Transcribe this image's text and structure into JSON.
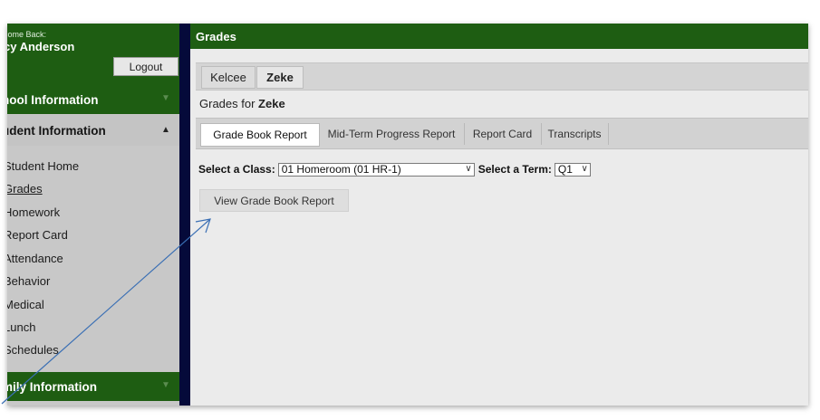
{
  "sidebar": {
    "welcome_small": "come Back:",
    "user_name": "cy Anderson",
    "logout_label": "Logout",
    "sections": {
      "school": "hool Information",
      "student": "udent Information",
      "family": "mily Information"
    },
    "items": [
      {
        "label": "Student Home"
      },
      {
        "label": "Grades"
      },
      {
        "label": "Homework"
      },
      {
        "label": "Report Card"
      },
      {
        "label": "Attendance"
      },
      {
        "label": "Behavior"
      },
      {
        "label": "Medical"
      },
      {
        "label": "Lunch"
      },
      {
        "label": "Schedules"
      }
    ]
  },
  "header": {
    "title": "Grades"
  },
  "students": [
    {
      "name": "Kelcee",
      "selected": false
    },
    {
      "name": "Zeke",
      "selected": true
    }
  ],
  "grades_for": {
    "prefix": "Grades for",
    "student": "Zeke"
  },
  "report_tabs": [
    {
      "label": "Grade Book Report",
      "active": true
    },
    {
      "label": "Mid-Term Progress Report",
      "active": false
    },
    {
      "label": "Report Card",
      "active": false
    },
    {
      "label": "Transcripts",
      "active": false
    }
  ],
  "filters": {
    "class_label": "Select a Class:",
    "class_value": "01 Homeroom (01 HR-1)",
    "term_label": "Select a Term:",
    "term_value": "Q1"
  },
  "view_button_label": "View Grade Book Report",
  "colors": {
    "header_green": "#1e5d12",
    "sidebar_gray": "#c8c8c8",
    "divider_navy": "#050a3a",
    "annotation_arrow": "#3a6fb4"
  }
}
